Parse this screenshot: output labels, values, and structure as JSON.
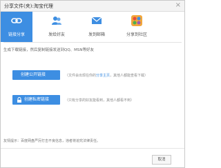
{
  "window": {
    "title": "分享文件(夹):淘宝代理"
  },
  "tabs": [
    {
      "label": "链接分享",
      "icon": "link-share-icon",
      "active": true
    },
    {
      "label": "发给好友",
      "icon": "friends-icon",
      "active": false
    },
    {
      "label": "发到邮箱",
      "icon": "mail-icon",
      "active": false
    },
    {
      "label": "分享到社区",
      "icon": "community-icon",
      "active": false
    }
  ],
  "description": "生成下载链接，然后复制链接发送到QQ、MSN等好友",
  "public_link": {
    "button_label": "创建公开链接",
    "note_prefix": "（文件会出现在你的",
    "note_link": "分享主页",
    "note_suffix": "，其他人都能查看下载）"
  },
  "private_link": {
    "button_label": "创建私密链接",
    "note": "（只有分享的好友能看到，其他人都看不到）"
  },
  "footer_note": "友情提示：百度网盘严厉打击不良信息，违者将追究法律责任。",
  "cancel_label": "取消",
  "colors": {
    "accent": "#3d8ee2"
  }
}
